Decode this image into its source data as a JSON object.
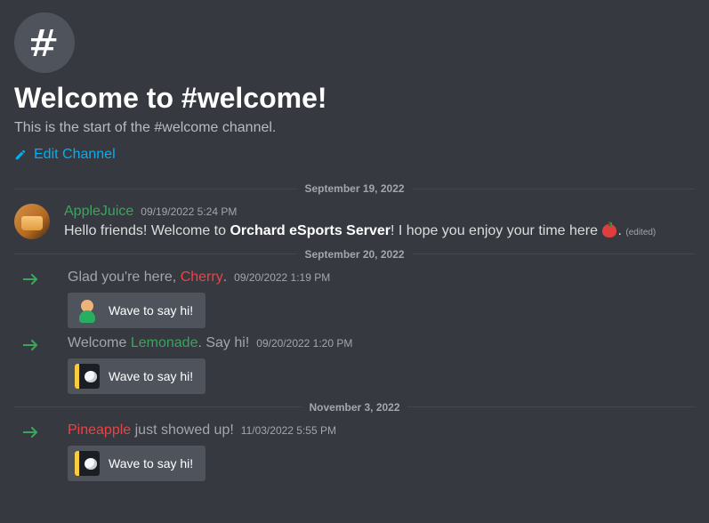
{
  "header": {
    "title": "Welcome to #welcome!",
    "subtitle": "This is the start of the #welcome channel.",
    "edit_label": "Edit Channel"
  },
  "dividers": {
    "d1": "September 19, 2022",
    "d2": "September 20, 2022",
    "d3": "November 3, 2022"
  },
  "message": {
    "author": "AppleJuice",
    "timestamp": "09/19/2022 5:24 PM",
    "text_prefix": "Hello friends! Welcome to ",
    "server_name": "Orchard eSports Server",
    "text_mid": "! I hope you enjoy your time here ",
    "text_end": ".",
    "edited": "(edited)"
  },
  "joins": [
    {
      "pre": "Glad you're here, ",
      "name": "Cherry",
      "name_class": "c-red",
      "post": ".",
      "timestamp": "09/20/2022 1:19 PM",
      "sticker": "person"
    },
    {
      "pre": "Welcome ",
      "name": "Lemonade",
      "name_class": "c-green",
      "post": ". Say hi!",
      "timestamp": "09/20/2022 1:20 PM",
      "sticker": "wumpus"
    },
    {
      "pre": "",
      "name": "Pineapple",
      "name_class": "c-red",
      "post": " just showed up!",
      "timestamp": "11/03/2022 5:55 PM",
      "sticker": "wumpus"
    }
  ],
  "wave_label": "Wave to say hi!"
}
